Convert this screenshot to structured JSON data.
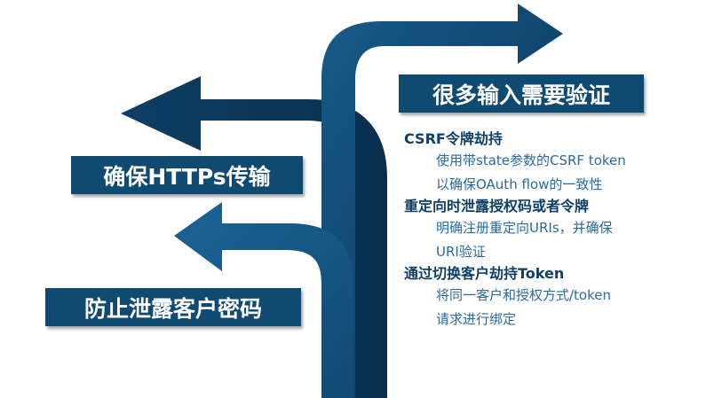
{
  "colors": {
    "arrow_dark": "#0a3557",
    "arrow_light": "#175a89",
    "label_bg": "#0f4a72",
    "heading_text": "#0f3f66",
    "body_text": "#2a6aa0"
  },
  "labels": {
    "top": "很多输入需要验证",
    "middle": "确保HTTPs传输",
    "bottom": "防止泄露客户密码"
  },
  "details": [
    {
      "heading": "CSRF令牌劫持",
      "lines": [
        "使用带state参数的CSRF token",
        "以确保OAuth flow的一致性"
      ]
    },
    {
      "heading": "重定向时泄露授权码或者令牌",
      "lines": [
        "明确注册重定向URIs，并确保",
        "URI验证"
      ]
    },
    {
      "heading": "通过切换客户劫持Token",
      "lines": [
        "将同一客户和授权方式/token",
        "请求进行绑定"
      ]
    }
  ]
}
